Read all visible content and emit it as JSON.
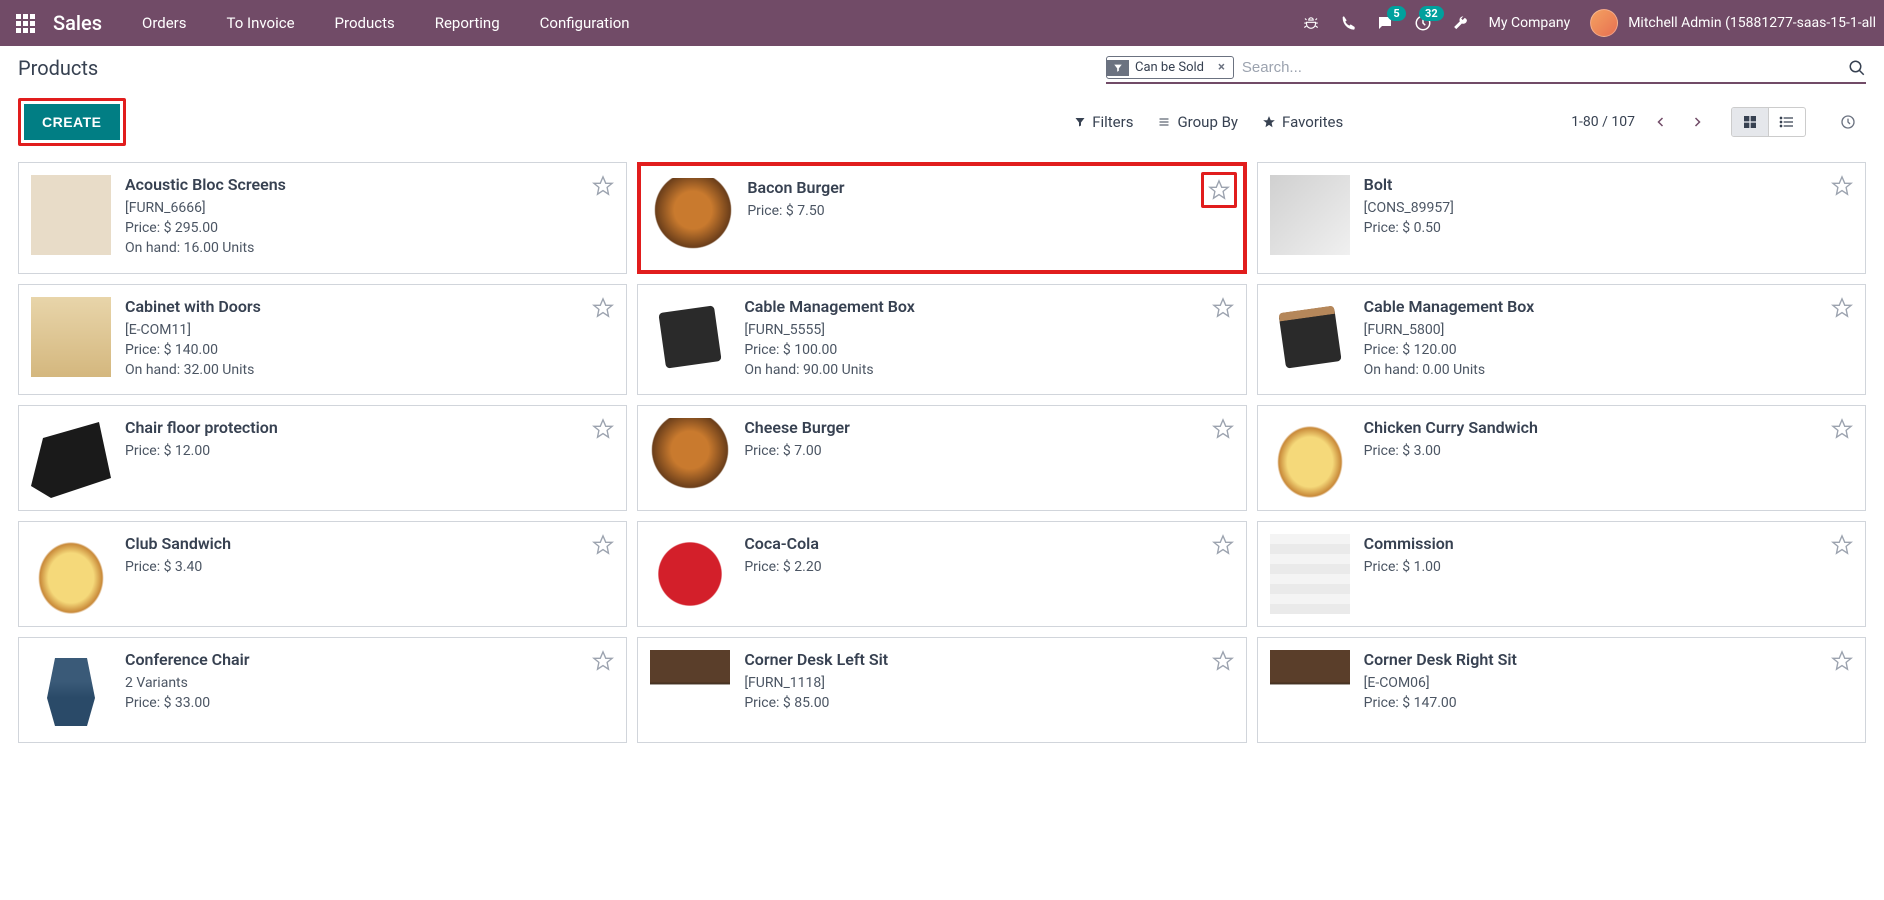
{
  "nav": {
    "brand": "Sales",
    "links": [
      "Orders",
      "To Invoice",
      "Products",
      "Reporting",
      "Configuration"
    ],
    "msg_count": "5",
    "activity_count": "32",
    "company": "My Company",
    "user": "Mitchell Admin (15881277-saas-15-1-all"
  },
  "header": {
    "title": "Products",
    "create": "CREATE",
    "filter_chip": "Can be Sold",
    "search_placeholder": "Search...",
    "filters": "Filters",
    "groupby": "Group By",
    "favorites": "Favorites",
    "pager": "1-80 / 107"
  },
  "products": [
    {
      "title": "Acoustic Bloc Screens",
      "ref": "[FURN_6666]",
      "price": "Price: $ 295.00",
      "onhand": "On hand: 16.00 Units",
      "ph": "ph-screen",
      "highlight": false,
      "star_boxed": false
    },
    {
      "title": "Bacon Burger",
      "ref": "",
      "price": "Price: $ 7.50",
      "onhand": "",
      "ph": "ph-burger",
      "highlight": true,
      "star_boxed": true
    },
    {
      "title": "Bolt",
      "ref": "[CONS_89957]",
      "price": "Price: $ 0.50",
      "onhand": "",
      "ph": "ph-bolt",
      "highlight": false,
      "star_boxed": false
    },
    {
      "title": "Cabinet with Doors",
      "ref": "[E-COM11]",
      "price": "Price: $ 140.00",
      "onhand": "On hand: 32.00 Units",
      "ph": "ph-cabinet",
      "highlight": false,
      "star_boxed": false
    },
    {
      "title": "Cable Management Box",
      "ref": "[FURN_5555]",
      "price": "Price: $ 100.00",
      "onhand": "On hand: 90.00 Units",
      "ph": "ph-cablebox",
      "highlight": false,
      "star_boxed": false
    },
    {
      "title": "Cable Management Box",
      "ref": "[FURN_5800]",
      "price": "Price: $ 120.00",
      "onhand": "On hand: 0.00 Units",
      "ph": "ph-cablebox2",
      "highlight": false,
      "star_boxed": false
    },
    {
      "title": "Chair floor protection",
      "ref": "",
      "price": "Price: $ 12.00",
      "onhand": "",
      "ph": "ph-mat",
      "highlight": false,
      "star_boxed": false
    },
    {
      "title": "Cheese Burger",
      "ref": "",
      "price": "Price: $ 7.00",
      "onhand": "",
      "ph": "ph-burger",
      "highlight": false,
      "star_boxed": false
    },
    {
      "title": "Chicken Curry Sandwich",
      "ref": "",
      "price": "Price: $ 3.00",
      "onhand": "",
      "ph": "ph-sandwich",
      "highlight": false,
      "star_boxed": false
    },
    {
      "title": "Club Sandwich",
      "ref": "",
      "price": "Price: $ 3.40",
      "onhand": "",
      "ph": "ph-sandwich",
      "highlight": false,
      "star_boxed": false
    },
    {
      "title": "Coca-Cola",
      "ref": "",
      "price": "Price: $ 2.20",
      "onhand": "",
      "ph": "ph-coke",
      "highlight": false,
      "star_boxed": false
    },
    {
      "title": "Commission",
      "ref": "",
      "price": "Price: $ 1.00",
      "onhand": "",
      "ph": "ph-commission",
      "highlight": false,
      "star_boxed": false
    },
    {
      "title": "Conference Chair",
      "ref": "2 Variants",
      "price": "Price: $ 33.00",
      "onhand": "",
      "ph": "ph-chair",
      "highlight": false,
      "star_boxed": false
    },
    {
      "title": "Corner Desk Left Sit",
      "ref": "[FURN_1118]",
      "price": "Price: $ 85.00",
      "onhand": "",
      "ph": "ph-desk",
      "highlight": false,
      "star_boxed": false
    },
    {
      "title": "Corner Desk Right Sit",
      "ref": "[E-COM06]",
      "price": "Price: $ 147.00",
      "onhand": "",
      "ph": "ph-desk",
      "highlight": false,
      "star_boxed": false
    }
  ]
}
